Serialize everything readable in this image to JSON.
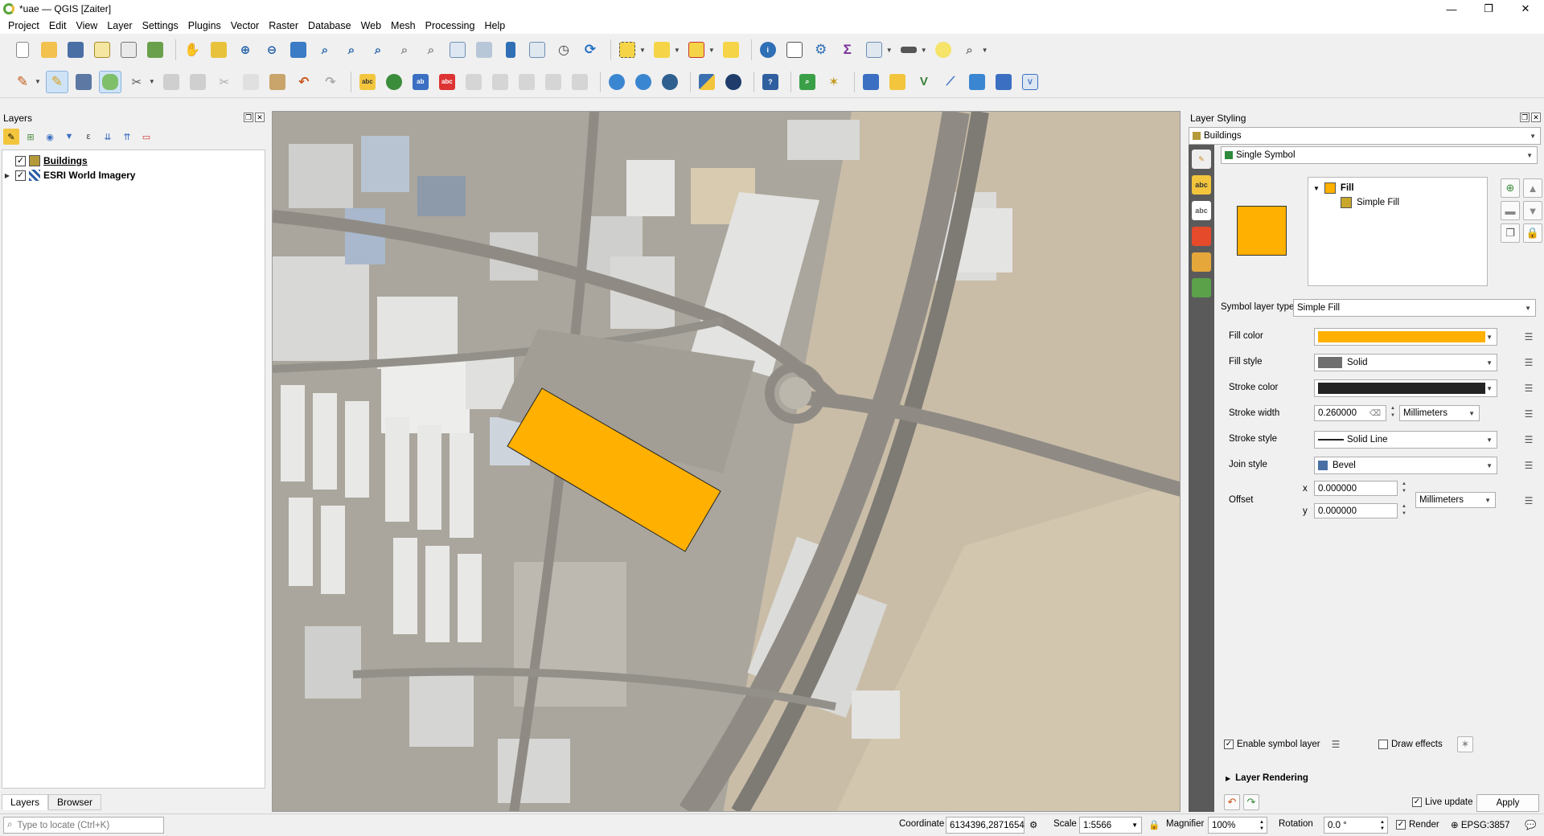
{
  "window": {
    "title": "*uae — QGIS [Zaiter]",
    "controls": {
      "minimize": "—",
      "maximize": "❐",
      "close": "✕"
    }
  },
  "menu": [
    "Project",
    "Edit",
    "View",
    "Layer",
    "Settings",
    "Plugins",
    "Vector",
    "Raster",
    "Database",
    "Web",
    "Mesh",
    "Processing",
    "Help"
  ],
  "toolbar1_icons": [
    "new-project",
    "open-project",
    "save-project",
    "new-print-layout",
    "show-layout-manager",
    "style-manager",
    "pan-map",
    "pan-to-selection",
    "zoom-in",
    "zoom-out",
    "zoom-full",
    "zoom-to-selection",
    "zoom-to-layer",
    "zoom-to-native",
    "zoom-last",
    "zoom-next",
    "new-map-view",
    "new-3d-map-view",
    "new-bookmark",
    "show-bookmarks",
    "temporal-controller",
    "refresh",
    "select-features",
    "select-by-value",
    "deselect-all",
    "select-by-location",
    "identify-features",
    "open-attribute-table",
    "processing-toolbox",
    "show-statistical-summary",
    "open-field-calculator",
    "measure-line",
    "map-tips",
    "locate"
  ],
  "toolbar2_icons": [
    "current-edits",
    "toggle-editing",
    "save-layer-edits",
    "add-polygon-feature",
    "vertex-tool",
    "modify-attributes",
    "delete-selected",
    "cut-features",
    "copy-features",
    "paste-features",
    "undo",
    "redo",
    "label-toolbar",
    "diagram",
    "highlight-pinned-labels",
    "show-hide-labels",
    "pin-labels",
    "move-label",
    "rotate-label",
    "change-label",
    "georeferencer",
    "add-wms-layer",
    "add-wfs-layer",
    "python-console",
    "earth-engine",
    "help-contents",
    "quick-osm",
    "vertex-tools",
    "digitize-tools",
    "shape-digitize",
    "split-features",
    "trace-tool",
    "advanced-digitizing",
    "grid-tool",
    "field-calc-bar"
  ],
  "layers_panel": {
    "title": "Layers",
    "layers": [
      {
        "name": "Buildings",
        "checked": "✓"
      },
      {
        "name": "ESRI World Imagery",
        "checked": "✓"
      }
    ],
    "tabs": [
      "Layers",
      "Browser"
    ]
  },
  "styling": {
    "title": "Layer Styling",
    "layer": "Buildings",
    "renderer": "Single Symbol",
    "tree": {
      "root": "Fill",
      "child": "Simple Fill"
    },
    "symbol_layer_type_label": "Symbol layer type",
    "symbol_layer_type": "Simple Fill",
    "fill_color_label": "Fill color",
    "fill_color": "#ffb000",
    "fill_style_label": "Fill style",
    "fill_style": "Solid",
    "stroke_color_label": "Stroke color",
    "stroke_color": "#232323",
    "stroke_width_label": "Stroke width",
    "stroke_width": "0.260000",
    "stroke_unit": "Millimeters",
    "stroke_style_label": "Stroke style",
    "stroke_style": "Solid Line",
    "join_style_label": "Join style",
    "join_style": "Bevel",
    "offset_label": "Offset",
    "offset_x_label": "x",
    "offset_x": "0.000000",
    "offset_y_label": "y",
    "offset_y": "0.000000",
    "offset_unit": "Millimeters",
    "enable_symbol_layer": "Enable symbol layer",
    "draw_effects": "Draw effects",
    "layer_rendering": "Layer Rendering",
    "live_update": "Live update",
    "apply": "Apply"
  },
  "status": {
    "locate_placeholder": "Type to locate (Ctrl+K)",
    "coordinate_label": "Coordinate",
    "coordinate": "6134396,2871654",
    "scale_label": "Scale",
    "scale": "1:5566",
    "magnifier_label": "Magnifier",
    "magnifier": "100%",
    "rotation_label": "Rotation",
    "rotation": "0.0 °",
    "render_label": "Render",
    "crs": "EPSG:3857"
  },
  "colors": {
    "selection_polygon": "#ffb000",
    "accent": "#3b7dd8"
  }
}
